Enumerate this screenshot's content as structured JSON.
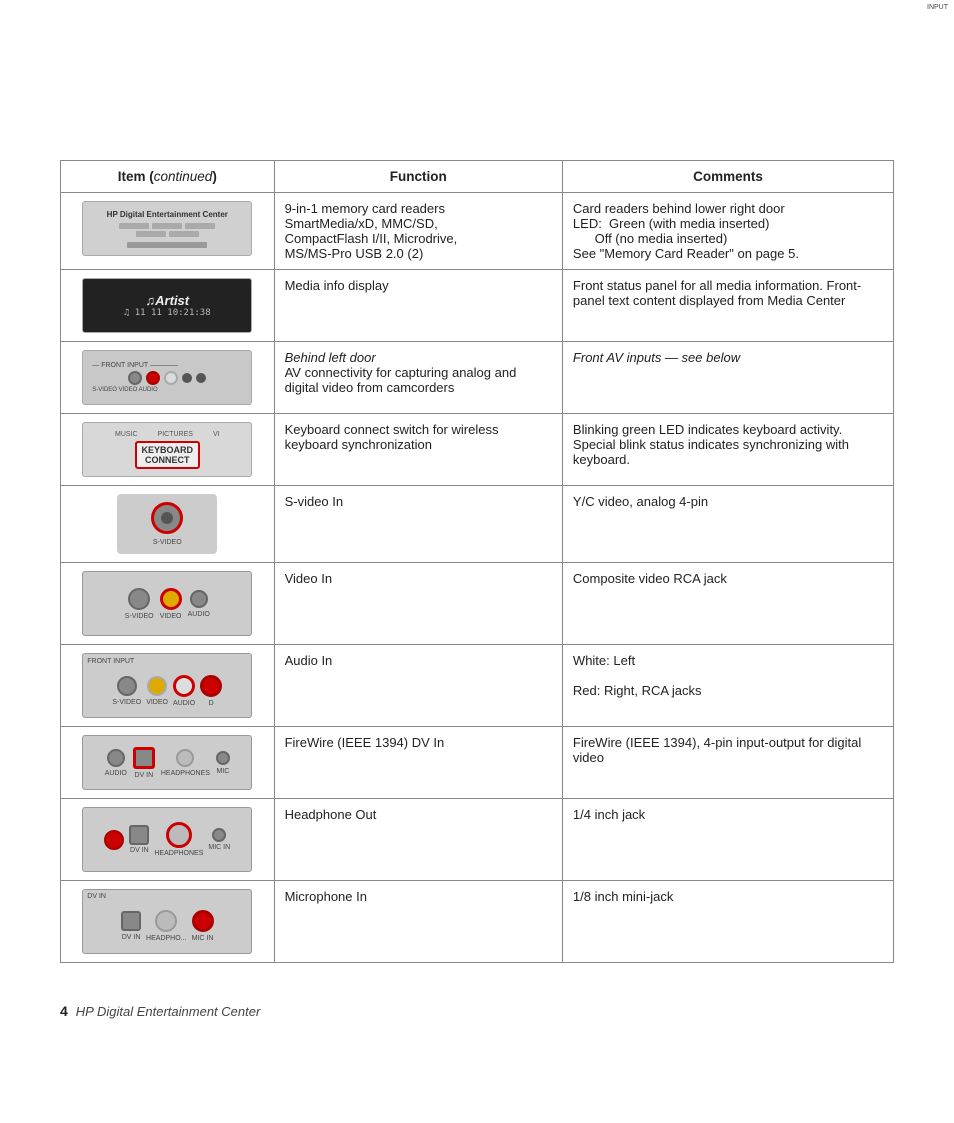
{
  "header": {
    "col1": "Item",
    "col1_cont": "continued",
    "col2": "Function",
    "col3": "Comments"
  },
  "rows": [
    {
      "id": "memory-card",
      "function": "9-in-1 memory card readers\nSmartMedia/xD, MMC/SD,\nCompactFlash I/II, Microdrive,\nMS/MS-Pro USB 2.0 (2)",
      "comments": "Card readers behind lower right door\nLED:  Green (with media inserted)\n      Off (no media inserted)\nSee “Memory Card Reader” on page 5."
    },
    {
      "id": "media-display",
      "function": "Media info display",
      "comments": "Front status panel for all media information. Front-panel text content displayed from Media Center"
    },
    {
      "id": "front-av",
      "function_line1": "Behind left door",
      "function_line2": "AV connectivity for capturing analog and digital video from camcorders",
      "comments": "Front AV inputs — see below"
    },
    {
      "id": "keyboard",
      "function": "Keyboard connect switch for wireless keyboard synchronization",
      "comments": "Blinking green LED indicates keyboard activity. Special blink status indicates synchronizing with keyboard."
    },
    {
      "id": "svideo",
      "function": "S-video In",
      "comments": "Y/C video, analog 4-pin"
    },
    {
      "id": "video-in",
      "function": "Video In",
      "comments": "Composite video RCA jack"
    },
    {
      "id": "audio-in",
      "function": "Audio In",
      "comments_line1": "White: Left",
      "comments_line2": "Red: Right, RCA jacks"
    },
    {
      "id": "firewire",
      "function": "FireWire (IEEE 1394) DV In",
      "comments": "FireWire (IEEE 1394), 4-pin input-output for digital video"
    },
    {
      "id": "headphone",
      "function": "Headphone Out",
      "comments": "1/4 inch jack"
    },
    {
      "id": "microphone",
      "function": "Microphone In",
      "comments": "1/8 inch mini-jack"
    }
  ],
  "footer": {
    "page_number": "4",
    "text": "HP Digital Entertainment Center"
  }
}
